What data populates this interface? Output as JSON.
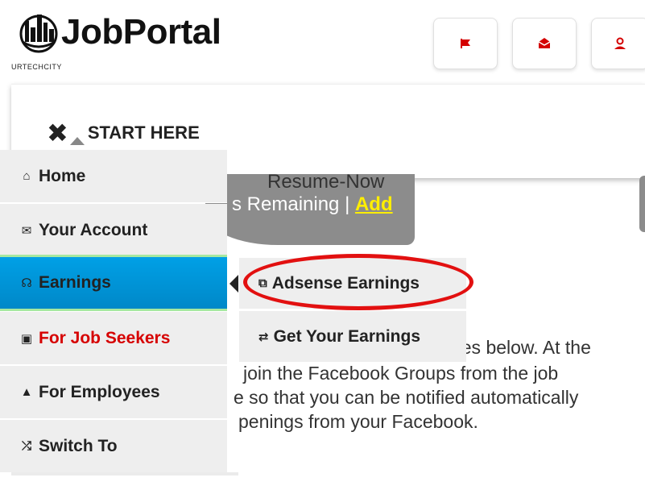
{
  "header": {
    "logo_text": "JobPortal",
    "logo_sub": "URTECHCITY",
    "buttons": [
      {
        "name": "flag-button",
        "icon": "flag-icon"
      },
      {
        "name": "inbox-button",
        "icon": "mail-icon"
      },
      {
        "name": "profile-button",
        "icon": "user-icon"
      }
    ]
  },
  "start_here": {
    "icon": "close-icon",
    "label": "START HERE"
  },
  "banner": {
    "resume_now": "Resume-Now",
    "remaining_text": "s Remaining | ",
    "add_label": "Add"
  },
  "menu": {
    "items": [
      {
        "icon_char": "⌂",
        "icon": "home-icon",
        "label": "Home"
      },
      {
        "icon_char": "✉",
        "icon": "account-icon",
        "label": "Your Account"
      },
      {
        "icon_char": "☊",
        "icon": "earnings-icon",
        "label": "Earnings"
      },
      {
        "icon_char": "▣",
        "icon": "job-seekers-icon",
        "label": "For Job Seekers"
      },
      {
        "icon_char": "▲",
        "icon": "employees-icon",
        "label": "For Employees"
      },
      {
        "icon_char": "⤮",
        "icon": "shuffle-icon",
        "label": "Switch To"
      }
    ]
  },
  "submenu": {
    "items": [
      {
        "icon_char": "⧉",
        "icon": "adsense-icon",
        "label": "Adsense Earnings"
      },
      {
        "icon_char": "⇄",
        "icon": "exchange-icon",
        "label": "Get Your Earnings"
      }
    ]
  },
  "body": {
    "line1": "ries below. At the",
    "line2": "join the Facebook Groups from the job",
    "line3": "e so that you can be notified automatically",
    "line4": "penings from your Facebook."
  },
  "colors": {
    "accent": "#0096d6",
    "highlight_oval": "#e21010",
    "red_text": "#d60000",
    "add_link": "#ffee00"
  }
}
